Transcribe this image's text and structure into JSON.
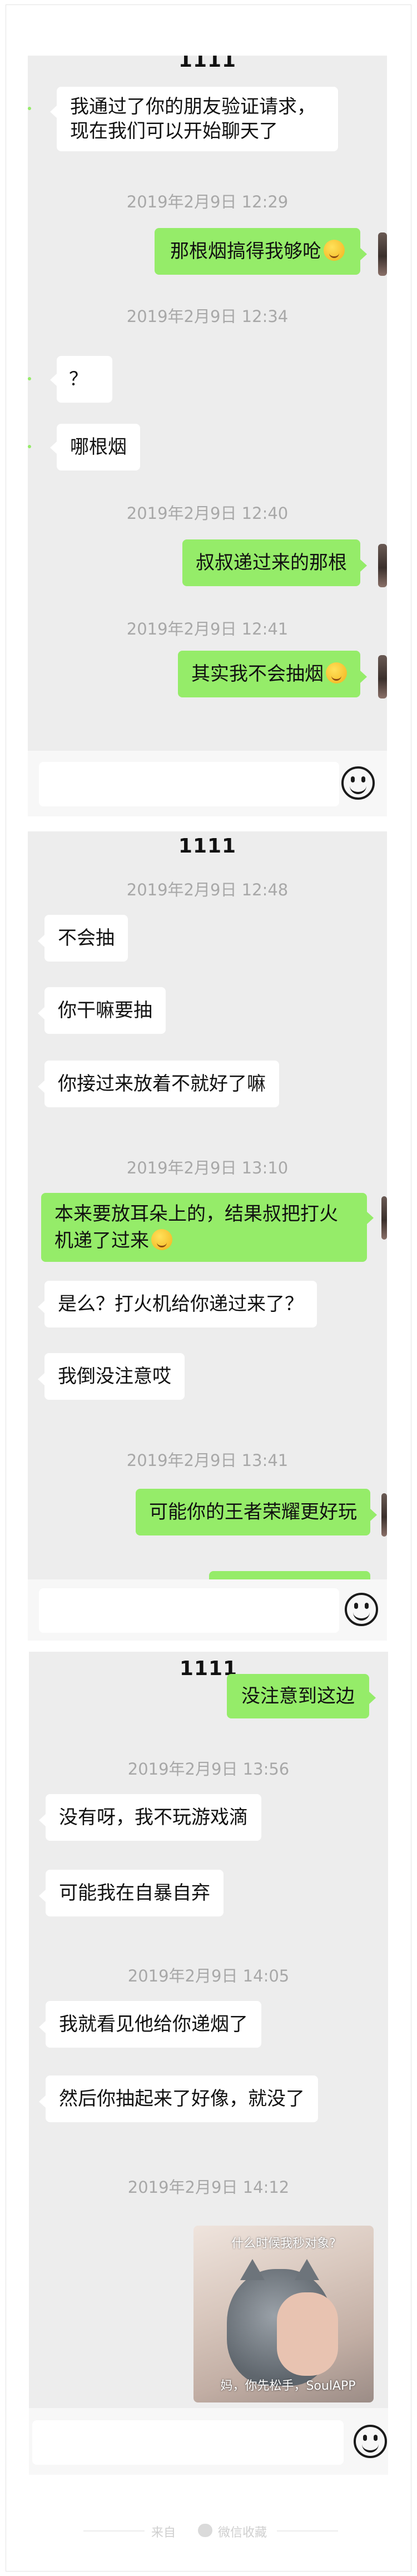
{
  "chat_title": "1111",
  "panel1": {
    "msg_verify": "我通过了你的朋友验证请求，现在我们可以开始聊天了",
    "ts1": "2019年2月9日 12:29",
    "msg_out1": "那根烟搞得我够呛",
    "ts2": "2019年2月9日 12:34",
    "msg_in_q": "？",
    "msg_in_which": "哪根烟",
    "ts3": "2019年2月9日 12:40",
    "msg_out2": "叔叔递过来的那根",
    "ts4": "2019年2月9日 12:41",
    "msg_out3": "其实我不会抽烟"
  },
  "panel2": {
    "ts1": "2019年2月9日 12:48",
    "msg_in1": "不会抽",
    "msg_in2": "你干嘛要抽",
    "msg_in3": "你接过来放着不就好了嘛",
    "ts2": "2019年2月9日 13:10",
    "msg_out1": "本来要放耳朵上的，结果叔把打火机递了过来",
    "msg_in4": "是么？打火机给你递过来了？",
    "msg_in5": "我倒没注意哎",
    "ts3": "2019年2月9日 13:41",
    "msg_out2": "可能你的王者荣耀更好玩"
  },
  "panel3": {
    "msg_out1": "没注意到这边",
    "ts1": "2019年2月9日 13:56",
    "msg_in1": "没有呀，我不玩游戏滴",
    "msg_in2": "可能我在自暴自弃",
    "ts2": "2019年2月9日 14:05",
    "msg_in3": "我就看见他给你递烟了",
    "msg_in4": "然后你抽起来了好像，就没了",
    "ts3": "2019年2月9日 14:12",
    "sticker_top": "什么时候我秒对象?",
    "sticker_bottom": "妈，你先松手，SoulAPP"
  },
  "footer": {
    "left": "来自",
    "right": "微信收藏"
  },
  "colors": {
    "chat_bg": "#ededed",
    "bubble_out": "#95ec69",
    "bubble_in": "#ffffff",
    "timestamp": "#a8a8a8"
  },
  "icons": [
    "emoji-icon",
    "smile-emoji-icon",
    "sticker-image"
  ]
}
